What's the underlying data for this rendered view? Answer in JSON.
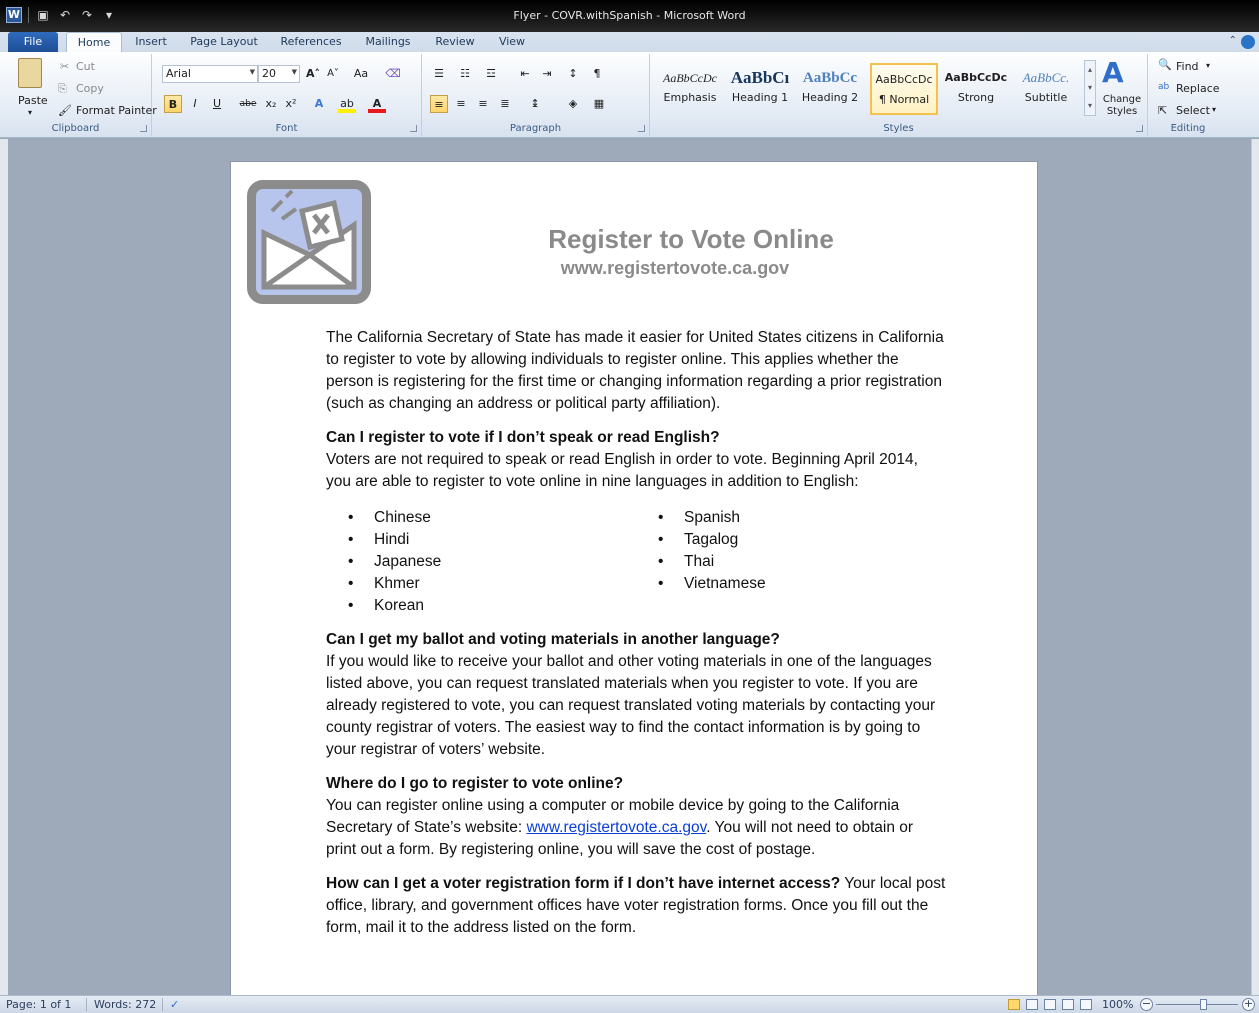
{
  "window": {
    "title": "Flyer - COVR.withSpanish - Microsoft Word"
  },
  "tabs": [
    "File",
    "Home",
    "Insert",
    "Page Layout",
    "References",
    "Mailings",
    "Review",
    "View"
  ],
  "ribbon": {
    "clipboard": {
      "paste": "Paste",
      "cut": "Cut",
      "copy": "Copy",
      "format_painter": "Format Painter",
      "label": "Clipboard"
    },
    "font": {
      "name": "Arial",
      "size": "20",
      "label": "Font",
      "bold": "B",
      "italic": "I",
      "underline": "U",
      "strike": "abe",
      "sub": "x₂",
      "sup": "x²",
      "change_case": "Aa"
    },
    "paragraph": {
      "label": "Paragraph"
    },
    "styles": {
      "label": "Styles",
      "items": [
        {
          "sample": "AaBbCcDc",
          "name": "Emphasis"
        },
        {
          "sample": "AaBbCı",
          "name": "Heading 1"
        },
        {
          "sample": "AaBbCc",
          "name": "Heading 2"
        },
        {
          "sample": "AaBbCcDc",
          "name": "¶ Normal"
        },
        {
          "sample": "AaBbCcDc",
          "name": "Strong"
        },
        {
          "sample": "AaBbCc.",
          "name": "Subtitle"
        }
      ],
      "change_styles": "Change Styles"
    },
    "editing": {
      "find": "Find",
      "replace": "Replace",
      "select": "Select",
      "label": "Editing"
    }
  },
  "document": {
    "title": "Register to Vote Online",
    "url": "www.registertovote.ca.gov",
    "intro": "The California Secretary of State has made it easier for United States citizens in California to register to vote by allowing individuals to register online.  This applies whether the person is registering for the first time or changing information regarding a prior registration (such as changing an address or political party affiliation).",
    "q1": "Can I register to vote if I don’t speak or read English?",
    "a1": "Voters are not required to speak or read English in order to vote.  Beginning April 2014, you are able to register to vote online in nine languages in addition to English:",
    "languages_left": [
      "Chinese",
      "Hindi",
      "Japanese",
      "Khmer",
      "Korean"
    ],
    "languages_right": [
      "Spanish",
      "Tagalog",
      "Thai",
      "Vietnamese"
    ],
    "q2": "Can I get my ballot and voting materials in another language?",
    "a2": "If you would like to receive your ballot and other voting materials in one of the languages listed above, you can request translated materials when you register to vote.  If you are already registered to vote, you can request translated voting materials by contacting your county registrar of voters.  The easiest way to find the contact information is by going to your registrar of voters’ website.",
    "q3": "Where do I go to register to vote online?",
    "a3_before": "You can register online using a computer or mobile device by going to the California Secretary of State’s website:  ",
    "a3_link": "www.registertovote.ca.gov",
    "a3_after": ".  You will not need to obtain or print out a form.  By registering online, you will save the cost of postage.",
    "q4": "How can I get a voter registration form if I don’t have internet access?",
    "a4": "  Your local post office, library, and government offices have voter registration forms.  Once you fill out the form, mail it to the address listed on the form."
  },
  "status": {
    "page": "Page: 1 of 1",
    "words": "Words: 272",
    "zoom": "100%"
  }
}
